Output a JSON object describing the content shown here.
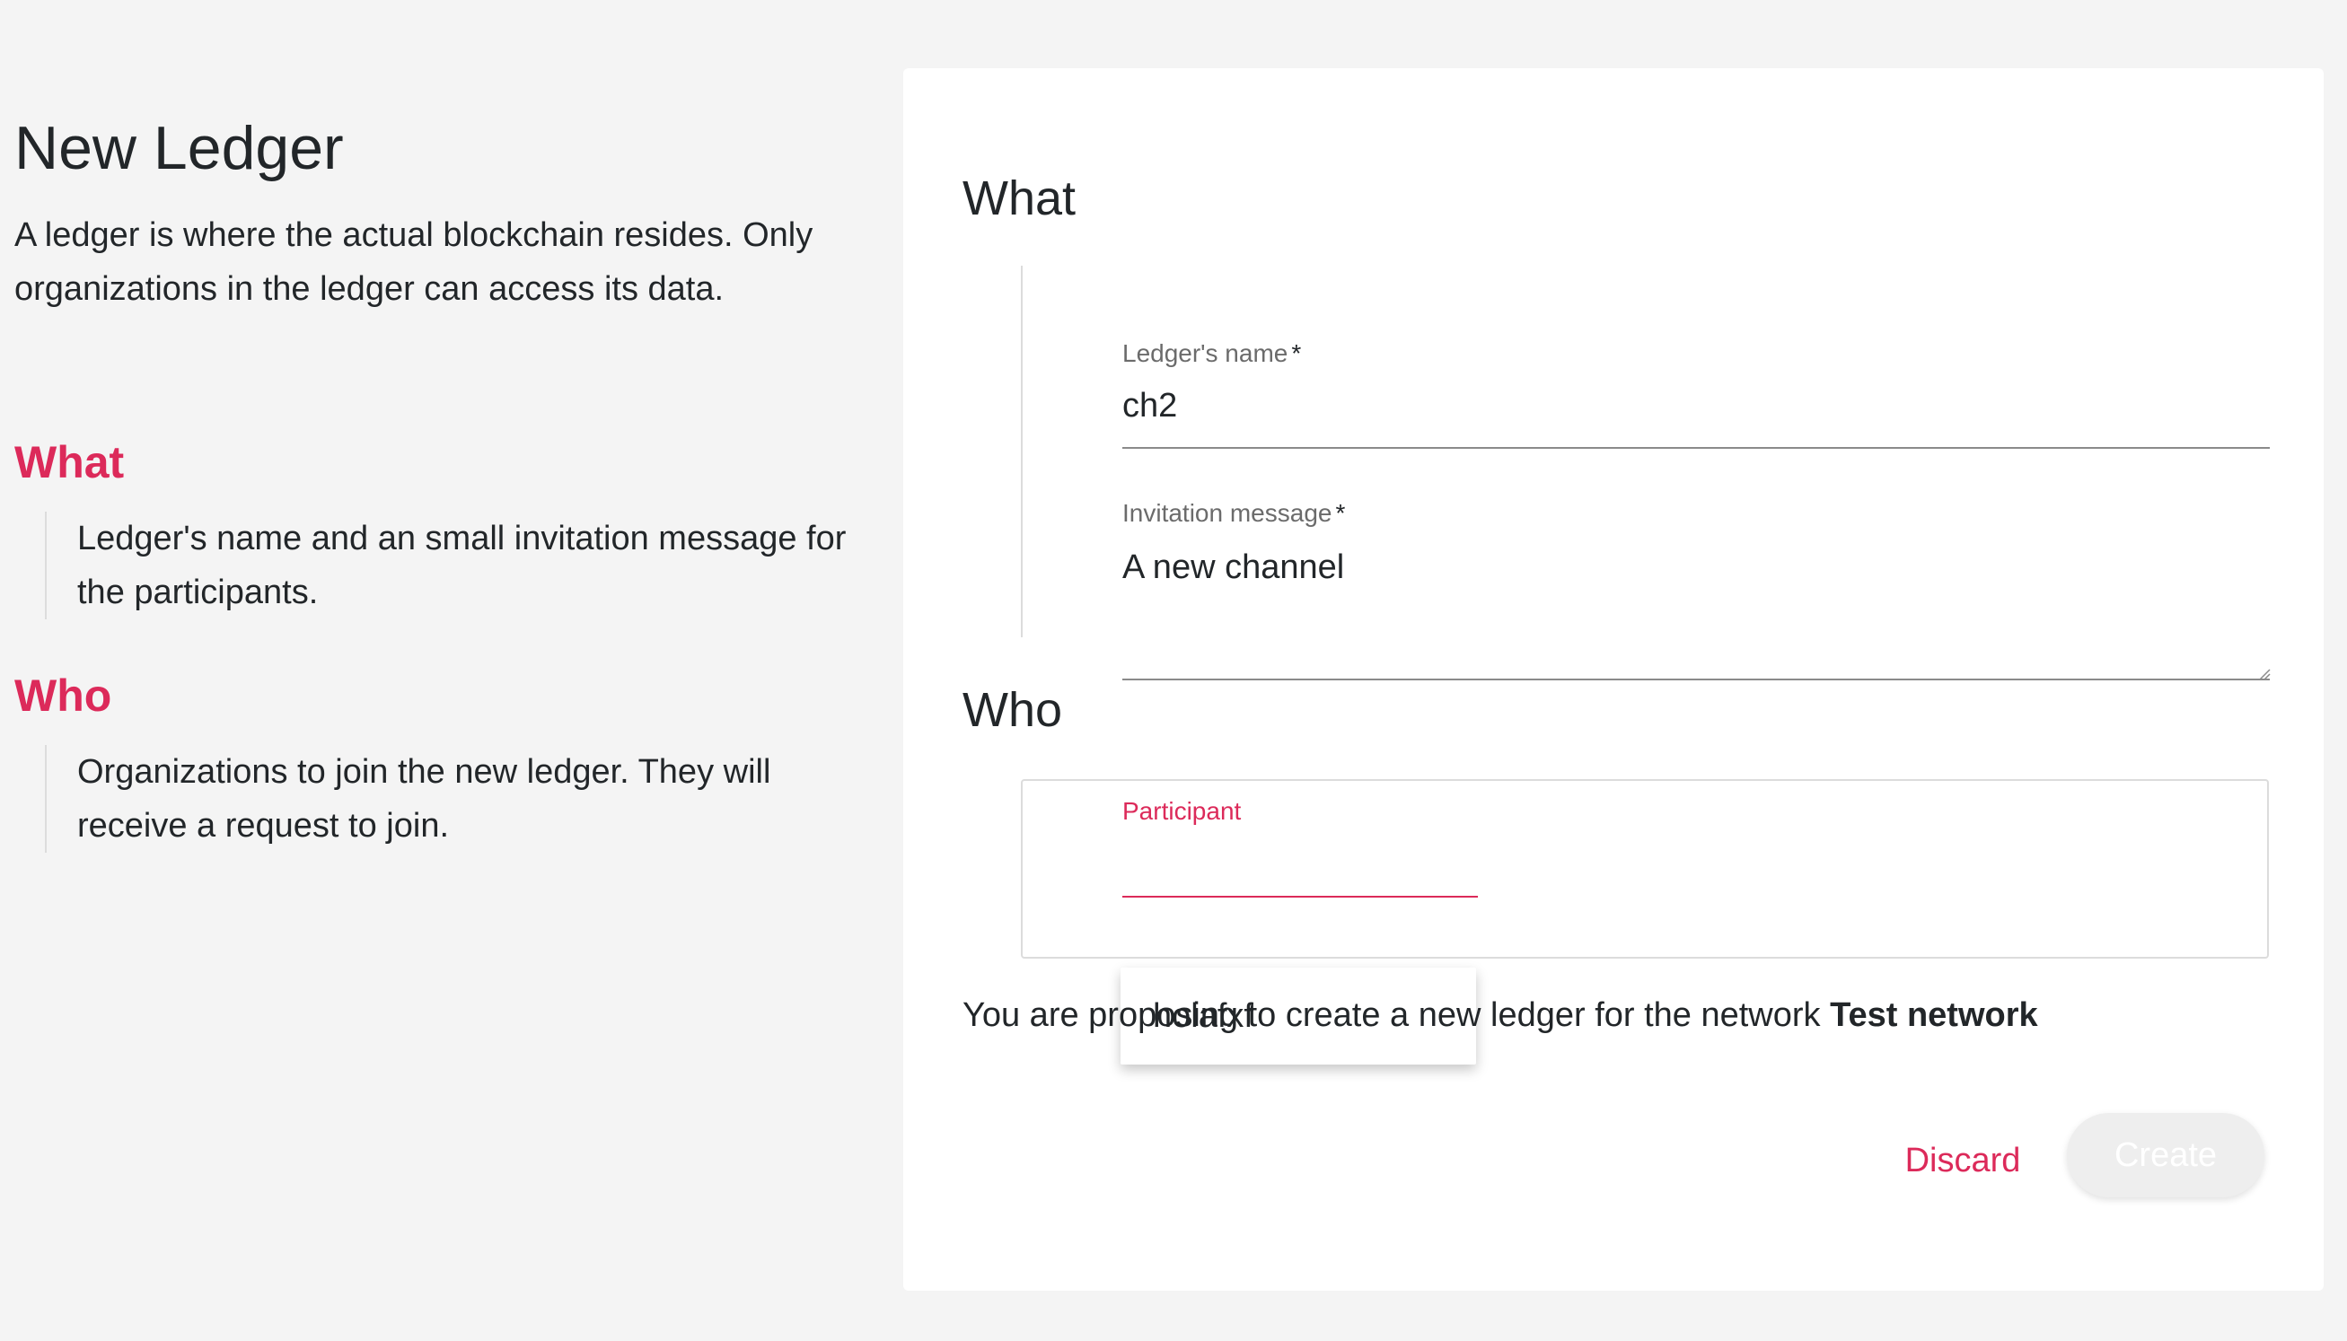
{
  "info": {
    "title": "New Ledger",
    "description": "A ledger is where the actual blockchain resides. Only organizations in the ledger can access its data.",
    "sections": [
      {
        "title": "What",
        "body": "Ledger's name and an small invitation message for the participants."
      },
      {
        "title": "Who",
        "body": "Organizations to join the new ledger. They will receive a request to join."
      }
    ]
  },
  "form": {
    "what_heading": "What",
    "who_heading": "Who",
    "name_label": "Ledger's name",
    "name_required": "*",
    "name_value": "ch2",
    "message_label": "Invitation message",
    "message_required": "*",
    "message_value": "A new channel",
    "participant_label": "Participant",
    "participant_value": "",
    "dropdown_options": [
      "holafxf"
    ],
    "note_prefix": "You are proposing to create a new ledger for the network",
    "network_name": "Test network",
    "discard_label": "Discard",
    "create_label": "Create"
  },
  "colors": {
    "accent": "#dc2a5a",
    "background": "#f4f4f4",
    "card": "#ffffff",
    "disabled_button": "#eeeeee"
  }
}
